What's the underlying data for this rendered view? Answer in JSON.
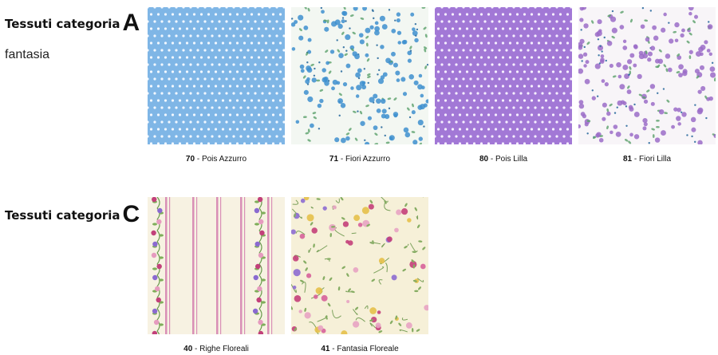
{
  "sections": [
    {
      "title": "Tessuti categoria",
      "letter": "A",
      "subtitle": "fantasia",
      "items": [
        {
          "code": "70",
          "sep": " - ",
          "name": "Pois Azzurro",
          "pattern": "dots",
          "bg": "#7fb6e6",
          "fg": "#f2f8ff"
        },
        {
          "code": "71",
          "sep": " - ",
          "name": "Fiori Azzurro",
          "pattern": "smallflowers",
          "bg": "#f3f7f2",
          "fg": "#3d8fcf"
        },
        {
          "code": "80",
          "sep": " - ",
          "name": "Pois Lilla",
          "pattern": "dots",
          "bg": "#a278d6",
          "fg": "#f6efff"
        },
        {
          "code": "81",
          "sep": " - ",
          "name": "Fiori Lilla",
          "pattern": "smallflowers",
          "bg": "#f8f5f8",
          "fg": "#9b6cc8"
        }
      ]
    },
    {
      "title": "Tessuti categoria",
      "letter": "C",
      "items": [
        {
          "code": "40",
          "sep": " - ",
          "name": "Righe Floreali",
          "pattern": "stripes",
          "bg": "#f7f2e2",
          "fg": "#c25591"
        },
        {
          "code": "41",
          "sep": " - ",
          "name": "Fantasia Floreale",
          "pattern": "floral",
          "bg": "#f6f0d8",
          "fg": "#c43f7a"
        }
      ]
    }
  ]
}
